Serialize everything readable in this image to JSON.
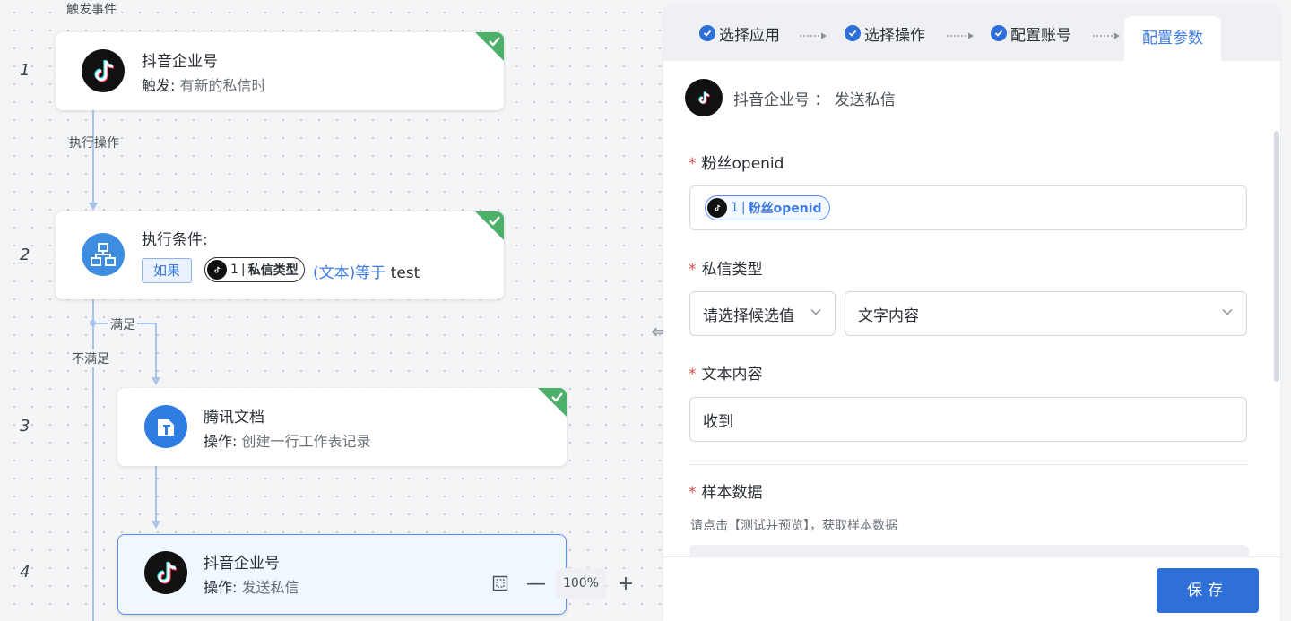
{
  "canvas": {
    "trigger_label": "触发事件",
    "step_numbers": [
      "1",
      "2",
      "3",
      "4"
    ],
    "edge_exec": "执行操作",
    "edge_satisfied": "满足",
    "edge_unsatisfied": "不满足",
    "nodes": [
      {
        "title": "抖音企业号",
        "sub_key": "触发:",
        "sub_val": "有新的私信时",
        "icon": "douyin-icon"
      },
      {
        "title": "执行条件:",
        "if_tag": "如果",
        "chip_num": "1",
        "chip_label": "私信类型",
        "cond_op": "(文本)等于",
        "cond_val": "test",
        "icon": "flowchart-icon"
      },
      {
        "title": "腾讯文档",
        "sub_key": "操作:",
        "sub_val": "创建一行工作表记录",
        "icon": "tencent-docs-icon"
      },
      {
        "title": "抖音企业号",
        "sub_key": "操作:",
        "sub_val": "发送私信",
        "icon": "douyin-icon"
      }
    ],
    "zoom": {
      "value": "100%",
      "minus": "—",
      "plus": "+"
    }
  },
  "panel": {
    "steps": [
      {
        "label": "选择应用",
        "done": true
      },
      {
        "label": "选择操作",
        "done": true
      },
      {
        "label": "配置账号",
        "done": true
      },
      {
        "label": "配置参数",
        "active": true
      }
    ],
    "app_header": "抖音企业号 ： 发送私信",
    "fields": {
      "openid_label": "粉丝openid",
      "openid_token_num": "1",
      "openid_token_label": "粉丝openid",
      "msgtype_label": "私信类型",
      "msgtype_select1": "请选择候选值",
      "msgtype_select2": "文字内容",
      "text_label": "文本内容",
      "text_value": "收到",
      "sample_label": "样本数据",
      "sample_hint": "请点击【测试并预览】，获取样本数据"
    },
    "save_label": "保存"
  },
  "colors": {
    "accent": "#2f6fd8",
    "link": "#3d7be0",
    "success": "#4caf6a",
    "required": "#e04a4a"
  }
}
